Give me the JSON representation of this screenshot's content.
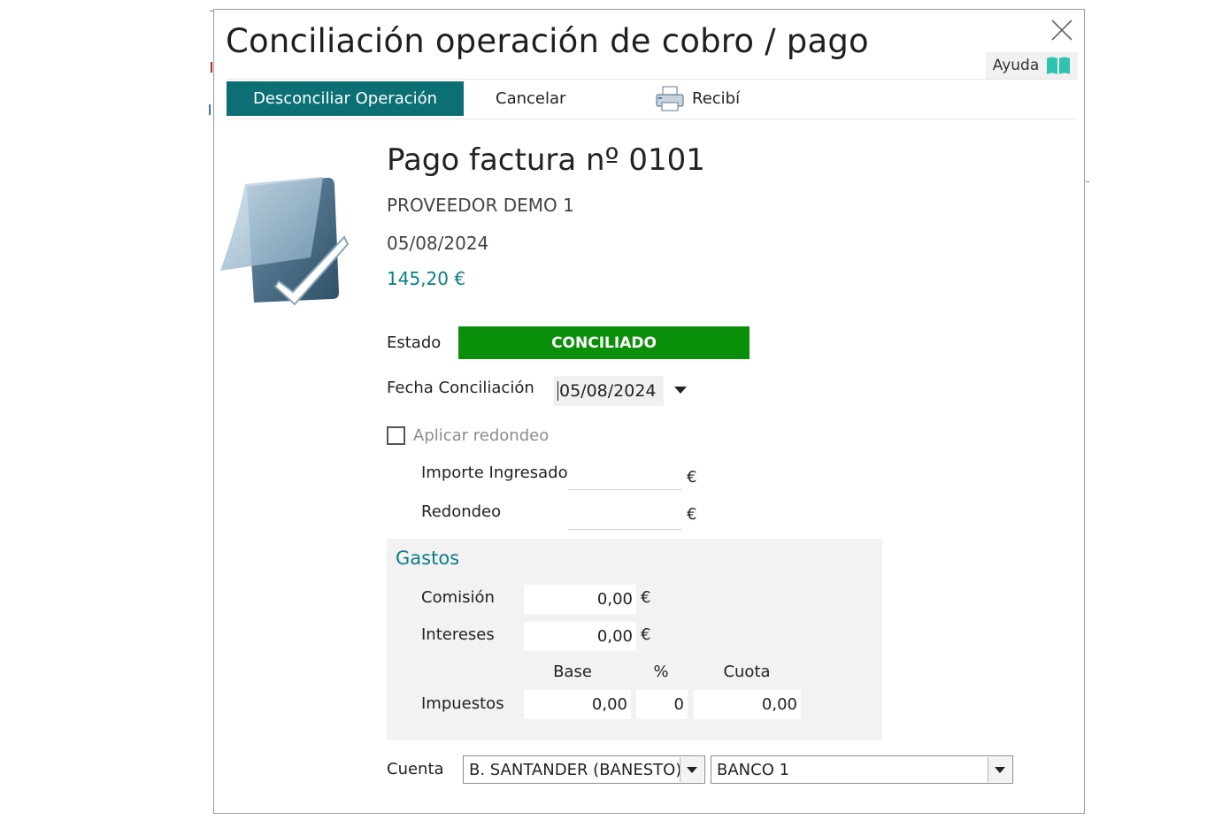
{
  "dialog": {
    "title": "Conciliación operación de cobro / pago",
    "help_label": "Ayuda"
  },
  "toolbar": {
    "unreconcile_label": "Desconciliar Operación",
    "cancel_label": "Cancelar",
    "receipt_label": "Recibí"
  },
  "operation": {
    "title": "Pago factura nº 0101",
    "supplier": "PROVEEDOR DEMO 1",
    "date": "05/08/2024",
    "amount": "145,20 €"
  },
  "status": {
    "label": "Estado",
    "value": "CONCILIADO",
    "color": "#0a8f0a"
  },
  "reconcile_date": {
    "label": "Fecha Conciliación",
    "value": "05/08/2024"
  },
  "rounding": {
    "checkbox_label": "Aplicar redondeo",
    "amount_label": "Importe Ingresado",
    "rounding_label": "Redondeo",
    "currency": "€"
  },
  "gastos": {
    "title": "Gastos",
    "commission_label": "Comisión",
    "commission_value": "0,00",
    "interest_label": "Intereses",
    "interest_value": "0,00",
    "currency": "€",
    "col_base": "Base",
    "col_pct": "%",
    "col_quota": "Cuota",
    "taxes_label": "Impuestos",
    "tax_base": "0,00",
    "tax_pct": "0",
    "tax_quota": "0,00"
  },
  "account": {
    "label": "Cuenta",
    "bank_value": "B. SANTANDER (BANESTO)",
    "sub_value": "BANCO 1"
  },
  "colors": {
    "accent": "#0b6f74",
    "amount": "#0b7f86",
    "status": "#0a8f0a"
  },
  "icons": {
    "close": "close-icon",
    "help": "book-icon",
    "receipt": "printer-icon",
    "document": "document-check-icon"
  }
}
